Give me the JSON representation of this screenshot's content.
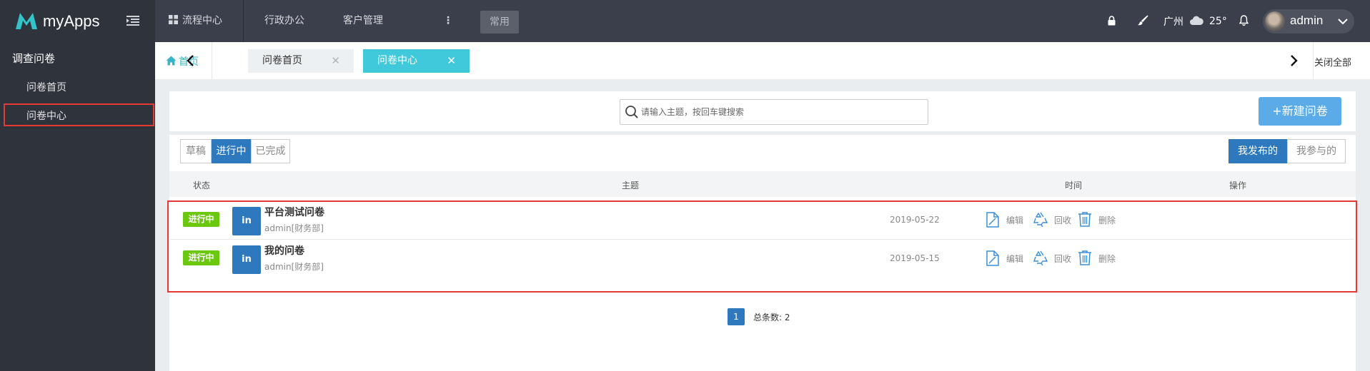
{
  "brand": {
    "name": "myApps"
  },
  "topnav": {
    "items": [
      "流程中心",
      "行政办公",
      "客户管理"
    ],
    "more": "⋮",
    "common_label": "常用"
  },
  "weather": {
    "city": "广州",
    "temp": "25°"
  },
  "user": {
    "name": "admin"
  },
  "sidebar": {
    "group": "调查问卷",
    "items": [
      {
        "label": "问卷首页",
        "active": false
      },
      {
        "label": "问卷中心",
        "active": true
      }
    ]
  },
  "tabs": {
    "home": "首页",
    "items": [
      {
        "label": "问卷首页",
        "active": false
      },
      {
        "label": "问卷中心",
        "active": true
      }
    ],
    "close_all": "关闭全部"
  },
  "search": {
    "placeholder": "请输入主题，按回车键搜索"
  },
  "new_button": "+新建问卷",
  "filters": {
    "status": [
      "草稿",
      "进行中",
      "已完成"
    ],
    "status_active": "进行中",
    "owner": [
      "我发布的",
      "我参与的"
    ],
    "owner_active": "我发布的"
  },
  "table": {
    "headers": {
      "status": "状态",
      "subject": "主题",
      "time": "时间",
      "actions": "操作"
    },
    "rows": [
      {
        "status": "进行中",
        "icon": "in",
        "title": "平台测试问卷",
        "sub": "admin[财务部]",
        "date": "2019-05-22"
      },
      {
        "status": "进行中",
        "icon": "in",
        "title": "我的问卷",
        "sub": "admin[财务部]",
        "date": "2019-05-15"
      }
    ],
    "actions": {
      "edit": "编辑",
      "recall": "回收",
      "delete": "删除"
    }
  },
  "pagination": {
    "current": "1",
    "total_label": "总条数: 2"
  },
  "colors": {
    "accent": "#2e78bd",
    "tab_active": "#3fc9da",
    "badge": "#6bc80f",
    "highlight": "#e53935"
  },
  "icons": [
    "logo-m-icon",
    "menu-toggle-icon",
    "grid-icon",
    "lock-icon",
    "brush-icon",
    "cloud-icon",
    "bell-icon",
    "chevron-down-icon",
    "home-icon",
    "chevron-left-icon",
    "chevron-right-icon",
    "close-icon",
    "search-icon",
    "edit-icon",
    "recycle-icon",
    "trash-icon"
  ]
}
